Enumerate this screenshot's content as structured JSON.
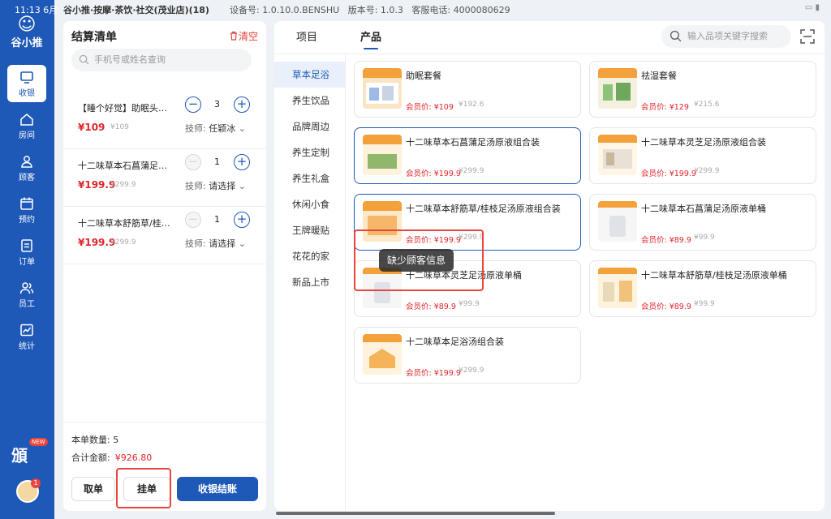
{
  "status_bar": {
    "time": "11:13",
    "date_fragment": "6月",
    "store": "谷小推·按摩·茶饮·社交(茂业店)(18)",
    "device_label": "设备号: 1.0.10.0.BENSHU",
    "version_label": "版本号: 1.0.3",
    "hotline_label": "客服电话: 4000080629"
  },
  "nav": {
    "logo_text": "谷小推",
    "items": [
      {
        "label": "收银",
        "icon": "monitor-icon",
        "active": true
      },
      {
        "label": "房间",
        "icon": "home-icon"
      },
      {
        "label": "顾客",
        "icon": "user-icon"
      },
      {
        "label": "预约",
        "icon": "calendar-icon"
      },
      {
        "label": "订单",
        "icon": "order-icon"
      },
      {
        "label": "员工",
        "icon": "staff-icon"
      },
      {
        "label": "统计",
        "icon": "chart-icon"
      }
    ],
    "promo_text": "頒",
    "promo_badge": "NEW",
    "avatar_badge": "1"
  },
  "order": {
    "title": "结算清单",
    "clear_label": "清空",
    "search_placeholder": "手机号或姓名查询",
    "items": [
      {
        "name": "【睡个好觉】助眠头…",
        "price": "¥109",
        "orig": "¥109",
        "qty": "3",
        "tech_label": "技师:",
        "tech_value": "任颖冰",
        "minus_enabled": true
      },
      {
        "name": "十二味草本石菖蒲足…",
        "price": "¥199.9",
        "orig": "¥299.9",
        "qty": "1",
        "tech_label": "技师:",
        "tech_value": "请选择",
        "minus_enabled": false
      },
      {
        "name": "十二味草本舒筋草/桂…",
        "price": "¥199.9",
        "orig": "¥299.9",
        "qty": "1",
        "tech_label": "技师:",
        "tech_value": "请选择",
        "minus_enabled": false
      }
    ],
    "count_label": "本单数量:",
    "count_value": "5",
    "total_label": "合计金额:",
    "total_value": "¥926.80",
    "btn_take": "取单",
    "btn_hang": "挂单",
    "btn_checkout": "收银结账"
  },
  "main": {
    "tabs": [
      {
        "label": "项目"
      },
      {
        "label": "产品",
        "active": true
      }
    ],
    "search_placeholder": "输入品项关键字搜索",
    "categories": [
      "草本足浴",
      "养生饮品",
      "品牌周边",
      "养生定制",
      "养生礼盒",
      "休闲小食",
      "王牌暖贴",
      "花花的家",
      "新品上市"
    ],
    "active_category": "草本足浴",
    "products": [
      {
        "name": "助眠套餐",
        "member_price": "会员价: ¥109",
        "orig_price": "¥192.6",
        "thumb": "sleep"
      },
      {
        "name": "祛湿套餐",
        "member_price": "会员价: ¥129",
        "orig_price": "¥215.6",
        "thumb": "damp"
      },
      {
        "name": "十二味草本石菖蒲足汤原液组合装",
        "member_price": "会员价: ¥199.9",
        "orig_price": "¥299.9",
        "thumb": "green",
        "selected": true
      },
      {
        "name": "十二味草本灵芝足汤原液组合装",
        "member_price": "会员价: ¥199.9",
        "orig_price": "¥299.9",
        "thumb": "box"
      },
      {
        "name": "十二味草本舒筋草/桂枝足汤原液组合装",
        "member_price": "会员价: ¥199.9",
        "orig_price": "¥299.9",
        "thumb": "orange",
        "selected": true
      },
      {
        "name": "十二味草本石菖蒲足汤原液单桶",
        "member_price": "会员价: ¥89.9",
        "orig_price": "¥99.9",
        "thumb": "bucket"
      },
      {
        "name": "十二味草本灵芝足汤原液单桶",
        "member_price": "会员价: ¥89.9",
        "orig_price": "¥99.9",
        "thumb": "bucket"
      },
      {
        "name": "十二味草本舒筋草/桂枝足汤原液单桶",
        "member_price": "会员价: ¥89.9",
        "orig_price": "¥99.9",
        "thumb": "bucket2"
      },
      {
        "name": "十二味草本足浴汤组合装",
        "member_price": "会员价: ¥199.9",
        "orig_price": "¥299.9",
        "thumb": "house"
      }
    ],
    "toast": "缺少顾客信息"
  },
  "colors": {
    "brand": "#1e59b8",
    "price_red": "#e0252b",
    "highlight_red": "#e8453c"
  }
}
